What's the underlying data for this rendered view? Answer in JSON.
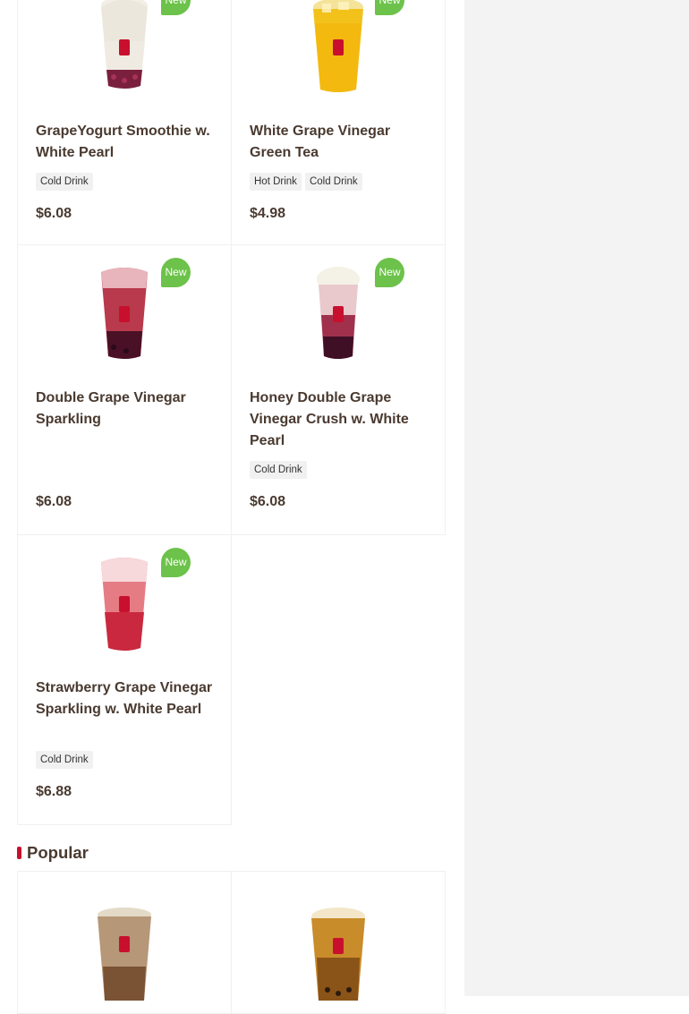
{
  "products": [
    {
      "name": "GrapeYogurt Smoothie w. White Pearl",
      "tags": [
        "Cold Drink"
      ],
      "price": "$6.08",
      "badge": "New",
      "drink": "grape-yogurt-smoothie"
    },
    {
      "name": "White Grape Vinegar Green Tea",
      "tags": [
        "Hot Drink",
        "Cold Drink"
      ],
      "price": "$4.98",
      "badge": "New",
      "drink": "white-grape-vinegar-green-tea"
    },
    {
      "name": "Double Grape Vinegar Sparkling",
      "tags": [],
      "price": "$6.08",
      "badge": "New",
      "drink": "double-grape-vinegar-sparkling"
    },
    {
      "name": "Honey Double Grape Vinegar Crush w. White Pearl",
      "tags": [
        "Cold Drink"
      ],
      "price": "$6.08",
      "badge": "New",
      "drink": "honey-double-grape-crush"
    },
    {
      "name": "Strawberry Grape Vinegar Sparkling w. White Pearl",
      "tags": [
        "Cold Drink"
      ],
      "price": "$6.88",
      "badge": "New",
      "drink": "strawberry-grape-vinegar-sparkling"
    }
  ],
  "section": {
    "title": "Popular"
  },
  "popular": [
    {
      "drink": "brown-sugar-milk-tea"
    },
    {
      "drink": "brown-sugar-pearl-tea"
    }
  ],
  "colors": {
    "badge": "#6cc24a",
    "accent": "#c8102e",
    "text": "#4a3a30"
  }
}
